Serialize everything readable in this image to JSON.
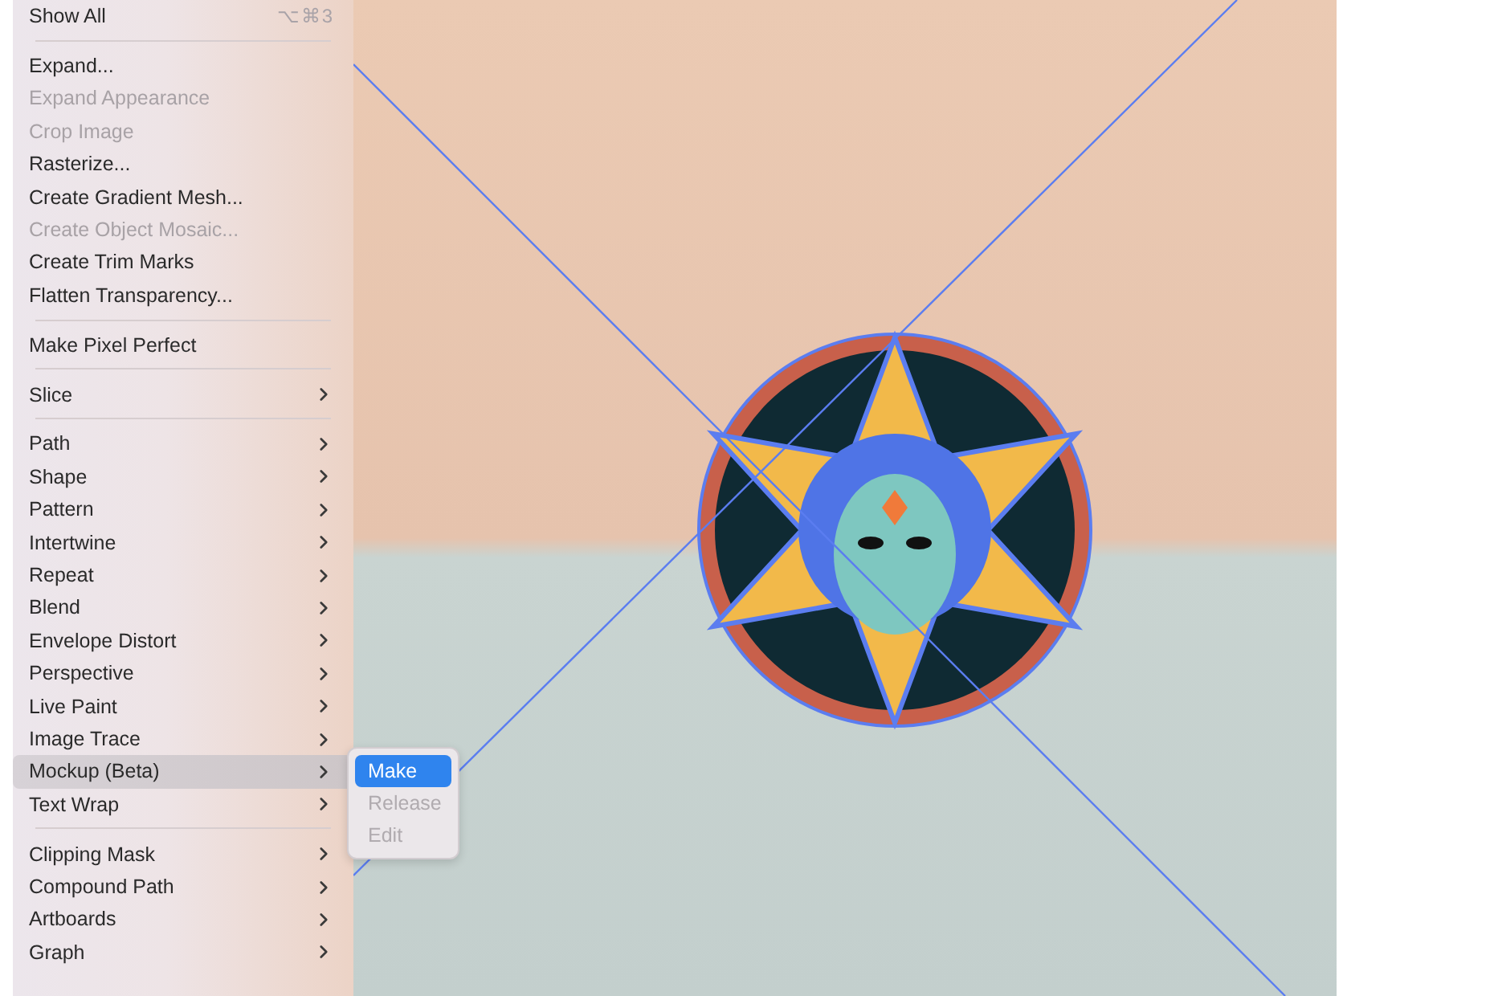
{
  "menu": {
    "sections": [
      {
        "items": [
          {
            "label": "Show All",
            "shortcut": "⌥⌘3",
            "disabled": false,
            "submenu": false,
            "selected": false
          }
        ]
      },
      {
        "items": [
          {
            "label": "Expand...",
            "disabled": false,
            "submenu": false,
            "selected": false
          },
          {
            "label": "Expand Appearance",
            "disabled": true,
            "submenu": false,
            "selected": false
          },
          {
            "label": "Crop Image",
            "disabled": true,
            "submenu": false,
            "selected": false
          },
          {
            "label": "Rasterize...",
            "disabled": false,
            "submenu": false,
            "selected": false
          },
          {
            "label": "Create Gradient Mesh...",
            "disabled": false,
            "submenu": false,
            "selected": false
          },
          {
            "label": "Create Object Mosaic...",
            "disabled": true,
            "submenu": false,
            "selected": false
          },
          {
            "label": "Create Trim Marks",
            "disabled": false,
            "submenu": false,
            "selected": false
          },
          {
            "label": "Flatten Transparency...",
            "disabled": false,
            "submenu": false,
            "selected": false
          }
        ]
      },
      {
        "items": [
          {
            "label": "Make Pixel Perfect",
            "disabled": false,
            "submenu": false,
            "selected": false
          }
        ]
      },
      {
        "items": [
          {
            "label": "Slice",
            "disabled": false,
            "submenu": true,
            "selected": false
          }
        ]
      },
      {
        "items": [
          {
            "label": "Path",
            "disabled": false,
            "submenu": true,
            "selected": false
          },
          {
            "label": "Shape",
            "disabled": false,
            "submenu": true,
            "selected": false
          },
          {
            "label": "Pattern",
            "disabled": false,
            "submenu": true,
            "selected": false
          },
          {
            "label": "Intertwine",
            "disabled": false,
            "submenu": true,
            "selected": false
          },
          {
            "label": "Repeat",
            "disabled": false,
            "submenu": true,
            "selected": false
          },
          {
            "label": "Blend",
            "disabled": false,
            "submenu": true,
            "selected": false
          },
          {
            "label": "Envelope Distort",
            "disabled": false,
            "submenu": true,
            "selected": false
          },
          {
            "label": "Perspective",
            "disabled": false,
            "submenu": true,
            "selected": false
          },
          {
            "label": "Live Paint",
            "disabled": false,
            "submenu": true,
            "selected": false
          },
          {
            "label": "Image Trace",
            "disabled": false,
            "submenu": true,
            "selected": false
          },
          {
            "label": "Mockup (Beta)",
            "disabled": false,
            "submenu": true,
            "selected": true
          },
          {
            "label": "Text Wrap",
            "disabled": false,
            "submenu": true,
            "selected": false
          }
        ]
      },
      {
        "items": [
          {
            "label": "Clipping Mask",
            "disabled": false,
            "submenu": true,
            "selected": false
          },
          {
            "label": "Compound Path",
            "disabled": false,
            "submenu": true,
            "selected": false
          },
          {
            "label": "Artboards",
            "disabled": false,
            "submenu": true,
            "selected": false
          },
          {
            "label": "Graph",
            "disabled": false,
            "submenu": true,
            "selected": false
          }
        ]
      }
    ]
  },
  "submenu": {
    "items": [
      {
        "label": "Make",
        "disabled": false,
        "selected": true
      },
      {
        "label": "Release",
        "disabled": true,
        "selected": false
      },
      {
        "label": "Edit",
        "disabled": true,
        "selected": false
      }
    ]
  }
}
